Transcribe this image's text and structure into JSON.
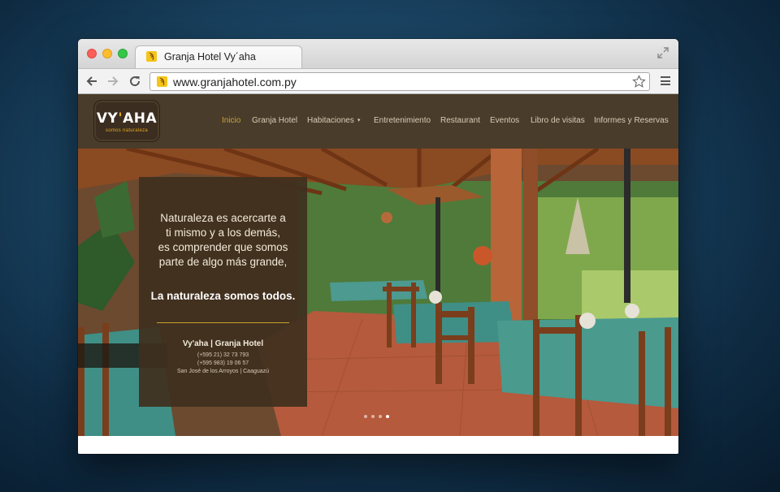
{
  "browser": {
    "tab_title": "Granja Hotel Vy´aha",
    "favicon_glyph": "ϡ",
    "url": "www.granjahotel.com.py"
  },
  "site": {
    "logo": {
      "main_a": "VY",
      "main_accent": "'",
      "main_b": "AHA",
      "sub": "somos naturaleza"
    },
    "nav": [
      {
        "label": "Inicio",
        "active": true
      },
      {
        "label": "Granja Hotel"
      },
      {
        "label": "Habitaciones",
        "caret": "▾"
      },
      {
        "label": "Entretenimiento"
      },
      {
        "label": "Restaurant"
      },
      {
        "label": "Eventos"
      },
      {
        "label": "Libro de visitas"
      },
      {
        "label": "Informes y Reservas"
      }
    ],
    "hero": {
      "quote_lines": [
        "Naturaleza es acercarte a",
        "ti mismo y a los demás,",
        "es comprender que somos",
        "parte de algo más grande,"
      ],
      "quote_highlight": "La naturaleza somos todos.",
      "hotel_name": "Vy'aha | Granja Hotel",
      "contact": [
        "(+595 21) 32 73 793",
        "(+595 983) 19 06 57",
        "San José de los Arroyos | Caaguazú"
      ],
      "slides_total": 4,
      "active_slide": 4
    }
  },
  "colors": {
    "header_bg": "#4a3c2a",
    "nav_active": "#c8a339",
    "accent_gold": "#e5a81f",
    "panel_bg": "#402f1e"
  }
}
